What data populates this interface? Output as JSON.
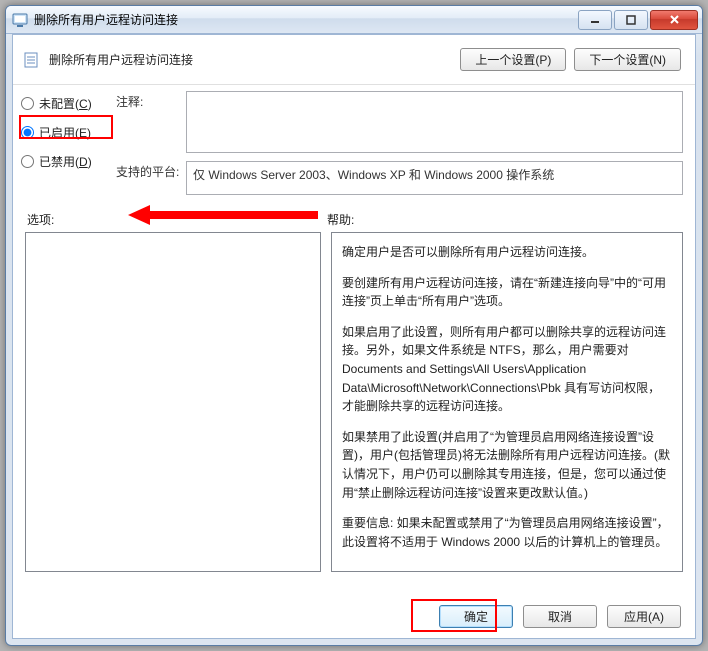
{
  "window": {
    "title": "删除所有用户远程访问连接"
  },
  "header": {
    "title": "删除所有用户远程访问连接",
    "prev": "上一个设置(P)",
    "next": "下一个设置(N)",
    "prev_key": "P",
    "next_key": "N"
  },
  "radios": {
    "not_configured": "未配置",
    "not_configured_key": "C",
    "enabled": "已启用",
    "enabled_key": "E",
    "disabled": "已禁用",
    "disabled_key": "D",
    "selected": "enabled"
  },
  "fields": {
    "comment_label": "注释:",
    "comment_value": "",
    "platform_label": "支持的平台:",
    "platform_value": "仅 Windows Server 2003、Windows XP 和 Windows 2000 操作系统"
  },
  "mid": {
    "options_label": "选项:",
    "help_label": "帮助:"
  },
  "help": {
    "p1": "确定用户是否可以删除所有用户远程访问连接。",
    "p2": "要创建所有用户远程访问连接，请在“新建连接向导”中的“可用连接”页上单击“所有用户”选项。",
    "p3": "如果启用了此设置，则所有用户都可以删除共享的远程访问连接。另外，如果文件系统是 NTFS，那么，用户需要对 Documents and Settings\\All Users\\Application Data\\Microsoft\\Network\\Connections\\Pbk 具有写访问权限，才能删除共享的远程访问连接。",
    "p4": "如果禁用了此设置(并启用了“为管理员启用网络连接设置”设置)，用户(包括管理员)将无法删除所有用户远程访问连接。(默认情况下，用户仍可以删除其专用连接，但是，您可以通过使用“禁止删除远程访问连接”设置来更改默认值。)",
    "p5": "重要信息: 如果未配置或禁用了“为管理员启用网络连接设置”，此设置将不适用于 Windows 2000 以后的计算机上的管理员。"
  },
  "footer": {
    "ok": "确定",
    "cancel": "取消",
    "apply": "应用(A)",
    "apply_key": "A"
  }
}
